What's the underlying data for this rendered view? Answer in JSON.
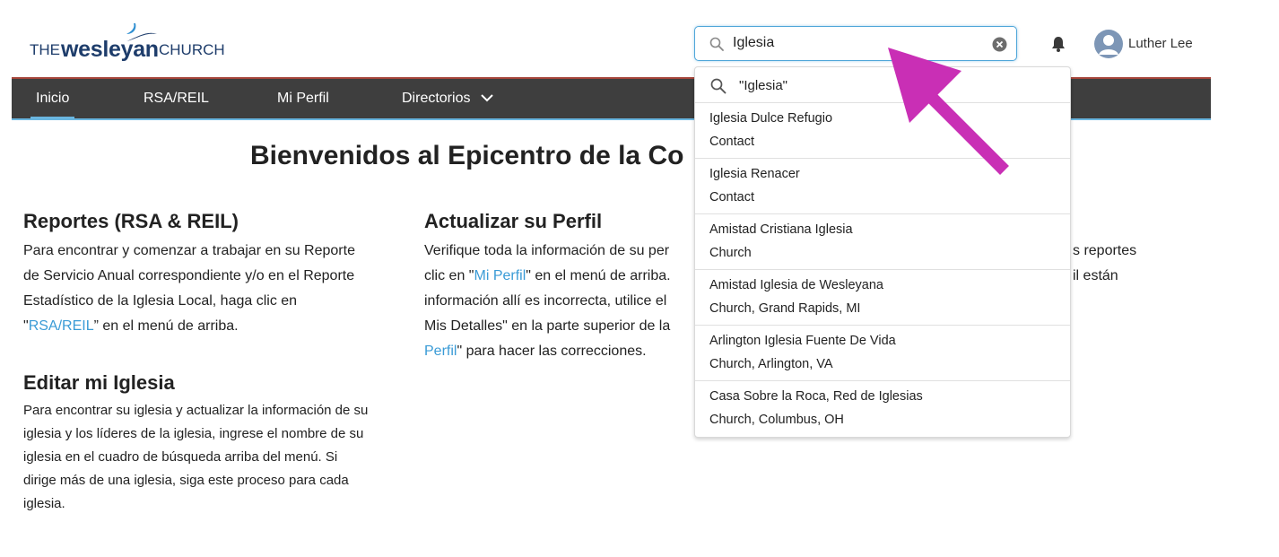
{
  "logo": {
    "the": "THE",
    "wesleyan": "wesleyan",
    "church": "CHURCH"
  },
  "search": {
    "value": "Iglesia",
    "placeholder": ""
  },
  "user": {
    "name": "Luther Lee"
  },
  "nav": {
    "items": [
      {
        "label": "Inicio",
        "active": true
      },
      {
        "label": "RSA/REIL"
      },
      {
        "label": "Mi Perfil"
      },
      {
        "label": "Directorios"
      }
    ]
  },
  "main": {
    "welcome": "Bienvenidos al Epicentro de la Co",
    "reportes": {
      "title": "Reportes (RSA & REIL)",
      "lines": [
        "Para encontrar y comenzar a trabajar en su Reporte",
        "de Servicio Anual correspondiente y/o en el Reporte",
        "Estadístico de la Iglesia Local, haga clic en"
      ],
      "line4_pre": "\"",
      "line4_link": "RSA/REIL",
      "line4_post": "” en el menú de arriba."
    },
    "editar": {
      "title": "Editar mi Iglesia",
      "lines": [
        "Para encontrar su iglesia y actualizar la información de su",
        "iglesia y los líderes de la iglesia, ingrese el nombre de su",
        "iglesia en el cuadro de búsqueda arriba del menú. Si",
        "dirige más de una iglesia, siga este proceso para cada",
        "iglesia."
      ]
    },
    "perfil": {
      "title": "Actualizar su Perfil",
      "line1": "Verifique toda la información de su per",
      "line2_pre": "clic en \"",
      "line2_link": "Mi Perfil",
      "line2_post": "\" en el menú de arriba.",
      "line3": "información allí es incorrecta, utilice el",
      "line4": "Mis Detalles\" en la parte superior de la",
      "line5_link": "Perfil",
      "line5_post": "\" para hacer las correcciones."
    },
    "right_partial": {
      "line1": "s reportes",
      "line2": "il están"
    }
  },
  "dropdown": {
    "query": "\"Iglesia\"",
    "results": [
      {
        "name": "Iglesia Dulce Refugio",
        "sub": "Contact"
      },
      {
        "name": "Iglesia Renacer",
        "sub": "Contact"
      },
      {
        "name": "Amistad Cristiana Iglesia",
        "sub": "Church"
      },
      {
        "name": "Amistad Iglesia de Wesleyana",
        "sub": "Church, Grand Rapids, MI"
      },
      {
        "name": "Arlington Iglesia Fuente De Vida",
        "sub": "Church, Arlington, VA"
      },
      {
        "name": "Casa Sobre la Roca, Red de Iglesias",
        "sub": "Church, Columbus, OH"
      }
    ]
  },
  "colors": {
    "brand_navy": "#1e3d6b",
    "brand_blue": "#3a9bd6",
    "nav_bg": "#3e3e3e",
    "annotation_arrow": "#c92fb5"
  }
}
